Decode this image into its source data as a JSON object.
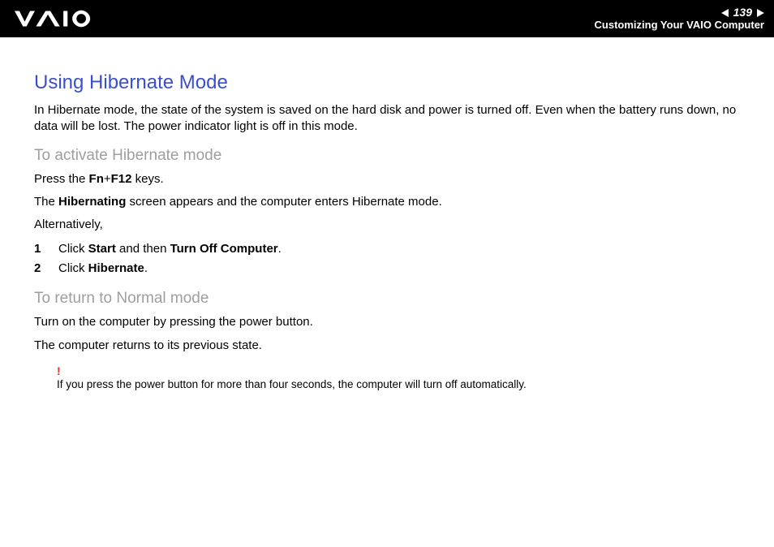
{
  "header": {
    "page_number": "139",
    "section": "Customizing Your VAIO Computer"
  },
  "title": "Using Hibernate Mode",
  "intro": "In Hibernate mode, the state of the system is saved on the hard disk and power is turned off. Even when the battery runs down, no data will be lost. The power indicator light is off in this mode.",
  "activate": {
    "heading": "To activate Hibernate mode",
    "press_prefix": "Press the ",
    "press_keys": "Fn",
    "press_plus": "+",
    "press_keys2": "F12",
    "press_suffix": " keys.",
    "screen_prefix": "The ",
    "screen_bold": "Hibernating",
    "screen_suffix": " screen appears and the computer enters Hibernate mode.",
    "alt": "Alternatively,",
    "step1_num": "1",
    "step1_a": "Click ",
    "step1_b": "Start",
    "step1_c": " and then ",
    "step1_d": "Turn Off Computer",
    "step1_e": ".",
    "step2_num": "2",
    "step2_a": "Click ",
    "step2_b": "Hibernate",
    "step2_c": "."
  },
  "return": {
    "heading": "To return to Normal mode",
    "p1": "Turn on the computer by pressing the power button.",
    "p2": "The computer returns to its previous state."
  },
  "note": {
    "bang": "!",
    "text": "If you press the power button for more than four seconds, the computer will turn off automatically."
  }
}
